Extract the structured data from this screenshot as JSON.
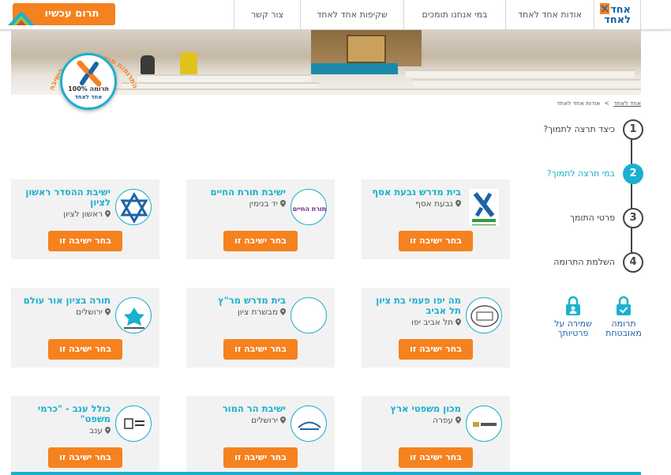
{
  "nav": {
    "logo_line1": "אחד",
    "logo_line2": "לאחד",
    "items": [
      "אודות אחד לאחד",
      "במי אנחנו תומכים",
      "שקיפות אחד לאחד",
      "צור קשר"
    ],
    "donate_now": "תרום עכשיו"
  },
  "hero": {
    "seal_percent": "100% תרומה",
    "seal_sub": "אחד לאחד",
    "arc_text": "כל כספי התרומות מועברים ישירות לישיבה"
  },
  "breadcrumb": [
    "אחד לאחד",
    "אודות אחד לאחד"
  ],
  "steps": [
    {
      "num": "1",
      "label": "כיצד תרצה לתמוך?"
    },
    {
      "num": "2",
      "label": "במי תרצה לתמוך?"
    },
    {
      "num": "3",
      "label": "פרטי התומך"
    },
    {
      "num": "4",
      "label": "השלמת התרומה"
    }
  ],
  "active_step": 2,
  "secure": {
    "secure_donation": "תרומה מאובטחת",
    "privacy": "שמירה על פרטיותך"
  },
  "choose_label": "בחר ישיבה זו",
  "cards": [
    {
      "name": "בית מדרש גבעת אסף",
      "location": "גבעת אסף"
    },
    {
      "name": "ישיבת תורת החיים",
      "location": "יד בנימין"
    },
    {
      "name": "ישיבת ההסדר ראשון לציון",
      "location": "ראשון לציון"
    },
    {
      "name": "מה יפו פעמי בת ציון תל אביב",
      "location": "תל אביב יפו"
    },
    {
      "name": "בית מדרש מר\"ץ",
      "location": "מבשרת ציון"
    },
    {
      "name": "תורה בציון אור עולם",
      "location": "ירושלים"
    },
    {
      "name": "מכון משפטי ארץ",
      "location": "עפרה"
    },
    {
      "name": "ישיבת הר המור",
      "location": "ירושלים"
    },
    {
      "name": "כולל ענב - \"כרמי משפט\"",
      "location": "ענב"
    }
  ],
  "colors": {
    "accent": "#1bb0cf",
    "orange": "#f5821f",
    "brand_blue": "#1d63a6"
  }
}
